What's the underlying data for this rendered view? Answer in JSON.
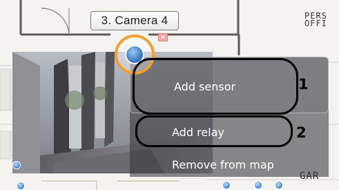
{
  "map": {
    "camera_label": "3. Camera 4",
    "close_symbol": "×",
    "room_label_top": "PERS\nOFFI",
    "room_label_bottom": "GAR"
  },
  "context_menu": {
    "items": [
      {
        "label": "Add sensor"
      },
      {
        "label": "Add relay"
      },
      {
        "label": "Remove from map"
      }
    ]
  },
  "annotations": {
    "marker_1": "1",
    "marker_2": "2"
  },
  "colors": {
    "camera_ring": "#f0a030",
    "menu_bg": "#3a3a3f",
    "highlight": "#000000"
  },
  "icons": {
    "camera_marker": "camera-icon",
    "close": "close-icon",
    "map_pins": "location-pin-icon"
  }
}
